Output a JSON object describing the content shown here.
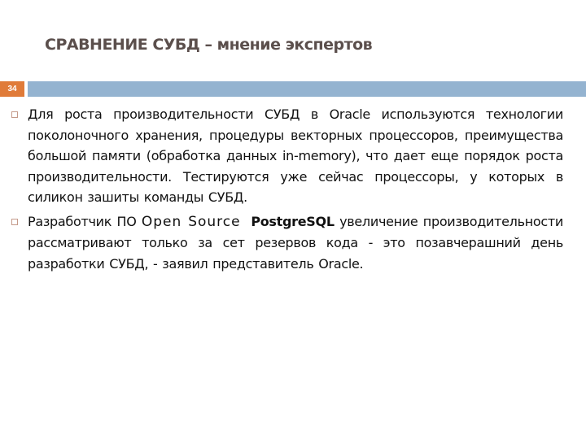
{
  "slide": {
    "number": "34",
    "title": {
      "main": "СРАВНЕНИЕ СУБД",
      "separator": " – ",
      "sub": "мнение экспертов"
    },
    "colors": {
      "title": "#5b4f4c",
      "badge": "#e07b39",
      "band": "#94b3d0",
      "bullet_border": "#c49a8a",
      "text": "#111111"
    },
    "bullets": [
      {
        "icon": "square-bullet-icon",
        "text": "Для роста производительности СУБД в Oracle используются технологии поколоночного хранения, процедуры векторных процессоров, преимущества большой памяти (обработка данных in-memory), что дает еще порядок роста производительности. Тестируются уже сейчас процессоры, у которых в силикон зашиты команды СУБД."
      },
      {
        "icon": "square-bullet-icon",
        "text_before": "Разработчик ПО ",
        "open_source": "Open Source",
        "spacer": "  ",
        "product": "PostgreSQL",
        "text_after": " увеличение производительности рассматривают только за сет резервов кода - это позавчерашний день разработки СУБД, - заявил представитель Oracle."
      }
    ]
  }
}
